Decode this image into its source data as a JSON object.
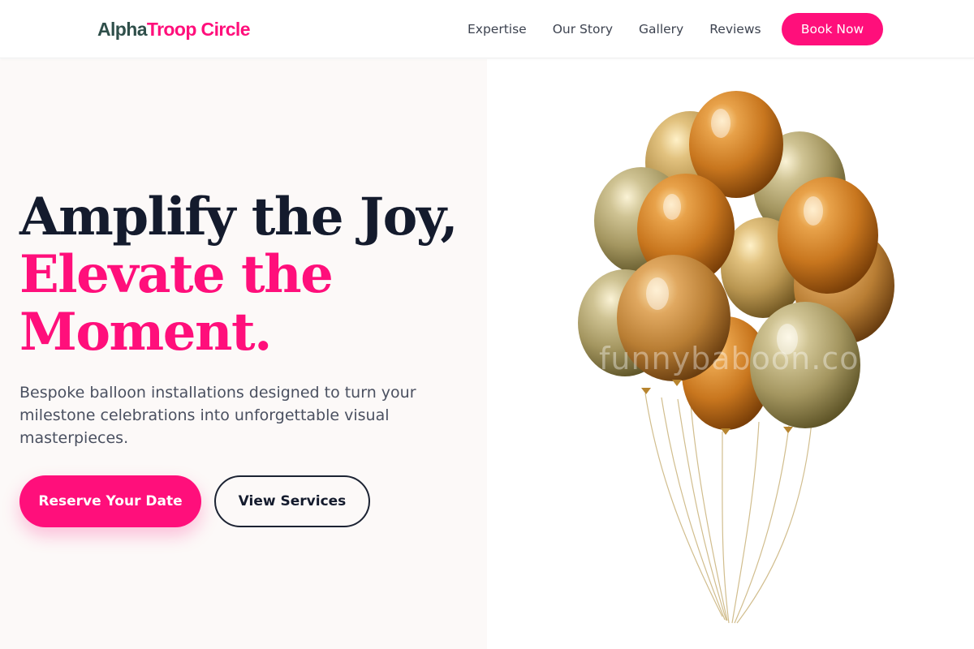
{
  "brand": {
    "part1": "Alpha",
    "part2": "Troop Circle"
  },
  "nav": {
    "links": [
      "Expertise",
      "Our Story",
      "Gallery",
      "Reviews"
    ],
    "cta": "Book Now"
  },
  "hero": {
    "headline_line1": "Amplify the Joy,",
    "headline_line2": "Elevate the",
    "headline_line3": "Moment.",
    "subtext": "Bespoke balloon installations designed to turn your milestone celebrations into unforgettable visual masterpieces.",
    "primary_button": "Reserve Your Date",
    "secondary_button": "View Services",
    "image_watermark": "funnybaboon.com"
  },
  "colors": {
    "accent": "#ff0f7b",
    "brand_dark": "#2f4f4a",
    "heading_dark": "#141b2d",
    "hero_left_bg": "#fcf9f8"
  },
  "icons": {
    "hero_image": "gold-balloon-bunch-illustration"
  }
}
